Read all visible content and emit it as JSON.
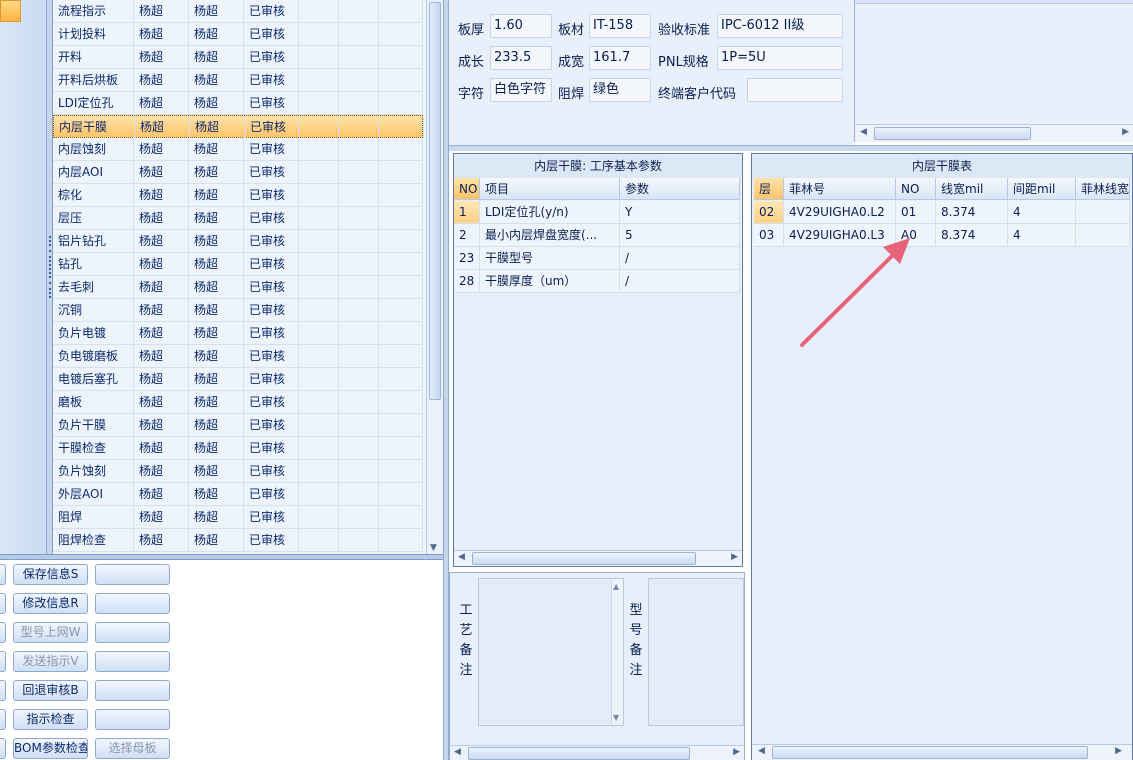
{
  "process_grid": {
    "rows": [
      {
        "name": "流程指示",
        "c1": "杨超",
        "c2": "杨超",
        "status": "已审核"
      },
      {
        "name": "计划投料",
        "c1": "杨超",
        "c2": "杨超",
        "status": "已审核"
      },
      {
        "name": "开料",
        "c1": "杨超",
        "c2": "杨超",
        "status": "已审核"
      },
      {
        "name": "开料后烘板",
        "c1": "杨超",
        "c2": "杨超",
        "status": "已审核"
      },
      {
        "name": "LDI定位孔",
        "c1": "杨超",
        "c2": "杨超",
        "status": "已审核"
      },
      {
        "name": "内层干膜",
        "c1": "杨超",
        "c2": "杨超",
        "status": "已审核"
      },
      {
        "name": "内层蚀刻",
        "c1": "杨超",
        "c2": "杨超",
        "status": "已审核"
      },
      {
        "name": "内层AOI",
        "c1": "杨超",
        "c2": "杨超",
        "status": "已审核"
      },
      {
        "name": "棕化",
        "c1": "杨超",
        "c2": "杨超",
        "status": "已审核"
      },
      {
        "name": "层压",
        "c1": "杨超",
        "c2": "杨超",
        "status": "已审核"
      },
      {
        "name": "铝片钻孔",
        "c1": "杨超",
        "c2": "杨超",
        "status": "已审核"
      },
      {
        "name": "钻孔",
        "c1": "杨超",
        "c2": "杨超",
        "status": "已审核"
      },
      {
        "name": "去毛刺",
        "c1": "杨超",
        "c2": "杨超",
        "status": "已审核"
      },
      {
        "name": "沉铜",
        "c1": "杨超",
        "c2": "杨超",
        "status": "已审核"
      },
      {
        "name": "负片电镀",
        "c1": "杨超",
        "c2": "杨超",
        "status": "已审核"
      },
      {
        "name": "负电镀磨板",
        "c1": "杨超",
        "c2": "杨超",
        "status": "已审核"
      },
      {
        "name": "电镀后塞孔",
        "c1": "杨超",
        "c2": "杨超",
        "status": "已审核"
      },
      {
        "name": "磨板",
        "c1": "杨超",
        "c2": "杨超",
        "status": "已审核"
      },
      {
        "name": "负片干膜",
        "c1": "杨超",
        "c2": "杨超",
        "status": "已审核"
      },
      {
        "name": "干膜检查",
        "c1": "杨超",
        "c2": "杨超",
        "status": "已审核"
      },
      {
        "name": "负片蚀刻",
        "c1": "杨超",
        "c2": "杨超",
        "status": "已审核"
      },
      {
        "name": "外层AOI",
        "c1": "杨超",
        "c2": "杨超",
        "status": "已审核"
      },
      {
        "name": "阻焊",
        "c1": "杨超",
        "c2": "杨超",
        "status": "已审核"
      },
      {
        "name": "阻焊检查",
        "c1": "杨超",
        "c2": "杨超",
        "status": "已审核"
      }
    ],
    "selected_row": 5
  },
  "buttons": [
    {
      "label": "保存信息S",
      "disabled": false,
      "has_side": true,
      "side_label": ""
    },
    {
      "label": "修改信息R",
      "disabled": false,
      "has_side": true,
      "side_label": ""
    },
    {
      "label": "型号上网W",
      "disabled": true,
      "has_side": true,
      "side_label": ""
    },
    {
      "label": "发送指示V",
      "disabled": true,
      "has_side": true,
      "side_label": ""
    },
    {
      "label": "回退审核B",
      "disabled": false,
      "has_side": true,
      "side_label": ""
    },
    {
      "label": "指示检查",
      "disabled": false,
      "has_side": true,
      "side_label": ""
    },
    {
      "label": "BOM参数检查",
      "disabled": false,
      "has_side": true,
      "side_label": "选择母板"
    }
  ],
  "info": {
    "board_thickness_label": "板厚",
    "board_thickness": "1.60",
    "material_label": "板材",
    "material": "IT-158",
    "acceptance_label": "验收标准",
    "acceptance": "IPC-6012 II级",
    "length_label": "成长",
    "length": "233.5",
    "width_label": "成宽",
    "width": "161.7",
    "pnl_label": "PNL规格",
    "pnl": "1P=5U",
    "char_label": "字符",
    "char_value": "白色字符",
    "mask_label": "阻焊",
    "mask_value": "绿色",
    "customer_code_label": "终端客户代码",
    "customer_code": ""
  },
  "params_panel": {
    "title": "内层干膜: 工序基本参数",
    "headers": [
      "NO",
      "项目",
      "参数"
    ],
    "rows": [
      {
        "no": "1",
        "item": "LDI定位孔(y/n)",
        "value": "Y"
      },
      {
        "no": "2",
        "item": "最小内层焊盘宽度(...",
        "value": "5"
      },
      {
        "no": "23",
        "item": "干膜型号",
        "value": "/"
      },
      {
        "no": "28",
        "item": "干膜厚度（um）",
        "value": "/"
      }
    ]
  },
  "film_panel": {
    "title": "内层干膜表",
    "headers": [
      "层",
      "菲林号",
      "NO",
      "线宽mil",
      "间距mil",
      "菲林线宽"
    ],
    "rows": [
      {
        "layer": "02",
        "film": "4V29UIGHA0.L2",
        "no": "01",
        "line_width": "8.374",
        "spacing": "4",
        "film_width": ""
      },
      {
        "layer": "03",
        "film": "4V29UIGHA0.L3",
        "no": "A0",
        "line_width": "8.374",
        "spacing": "4",
        "film_width": ""
      }
    ]
  },
  "notes": {
    "process_label_chars": [
      "工",
      "艺",
      "备",
      "注"
    ],
    "model_label_chars": [
      "型",
      "号",
      "备",
      "注"
    ]
  },
  "annotation": {
    "color": "#e8637a"
  },
  "colors": {
    "accent_selected": "#ffc46a",
    "grid_bg": "#eef4fc",
    "border": "#5f7aa3"
  }
}
